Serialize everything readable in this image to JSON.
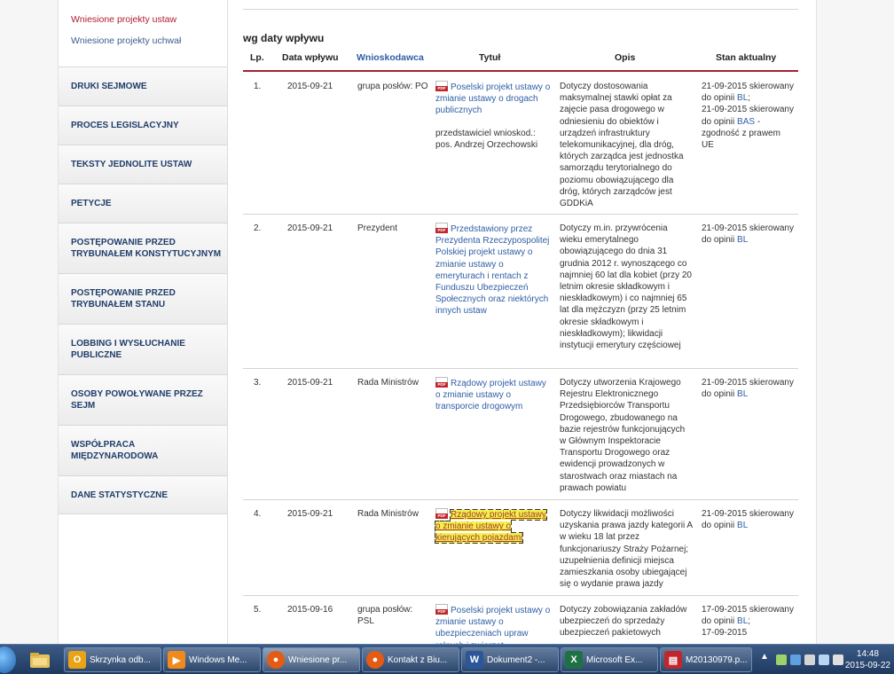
{
  "sidebar": {
    "sub_links": [
      "Wniesione projekty ustaw",
      "Wniesione projekty uchwał"
    ],
    "nav": [
      "DRUKI SEJMOWE",
      "PROCES LEGISLACYJNY",
      "TEKSTY JEDNOLITE USTAW",
      "PETYCJE",
      "POSTĘPOWANIE PRZED\nTRYBUNAŁEM KONSTYTUCYJNYM",
      "POSTĘPOWANIE PRZED\nTRYBUNAŁEM STANU",
      "LOBBING I WYSŁUCHANIE\nPUBLICZNE",
      "OSOBY POWOŁYWANE PRZEZ\nSEJM",
      "WSPÓŁPRACA\nMIĘDZYNARODOWA",
      "DANE STATYSTYCZNE"
    ]
  },
  "main": {
    "section_title": "wg daty wpływu",
    "headers": {
      "lp": "Lp.",
      "date": "Data wpływu",
      "applicant": "Wnioskodawca",
      "title": "Tytuł",
      "desc": "Opis",
      "state": "Stan aktualny"
    },
    "rows": [
      {
        "lp": "1.",
        "date": "2015-09-21",
        "applicant": "grupa posłów: PO",
        "title": "Poselski projekt ustawy o zmianie ustawy o drogach publicznych",
        "note": "przedstawiciel wnioskod.: pos. Andrzej Orzechowski",
        "desc": "Dotyczy dostosowania maksymalnej stawki opłat za zajęcie pasa drogowego w odniesieniu do obiektów i urządzeń infrastruktury telekomunikacyjnej, dla dróg, których zarządca jest jednostka samorządu terytorialnego do poziomu obowiązującego dla dróg, których zarządców jest GDDKiA",
        "state_1": "21-09-2015 skierowany do opinii",
        "state_1_link": "BL",
        "state_1_tail": ";",
        "state_2": "21-09-2015 skierowany do opinii",
        "state_2_link": "BAS",
        "state_2_tail": " - zgodność z prawem UE"
      },
      {
        "lp": "2.",
        "date": "2015-09-21",
        "applicant": "Prezydent",
        "title": "Przedstawiony przez Prezydenta Rzeczypospolitej Polskiej projekt ustawy o zmianie ustawy o emeryturach i rentach z Funduszu Ubezpieczeń Społecznych oraz niektórych innych ustaw",
        "desc": "Dotyczy m.in. przywrócenia wieku emerytalnego obowiązującego do dnia 31 grudnia 2012 r. wynoszącego co najmniej 60 lat dla kobiet (przy 20 letnim okresie składkowym i nieskładkowym) i co najmniej 65 lat dla mężczyzn (przy 25 letnim okresie składkowym i nieskładkowym); likwidacji instytucji emerytury częściowej",
        "state_1": "21-09-2015 skierowany do opinii",
        "state_1_link": "BL"
      },
      {
        "lp": "3.",
        "date": "2015-09-21",
        "applicant": "Rada Ministrów",
        "title": "Rządowy projekt ustawy o zmianie ustawy o transporcie drogowym",
        "desc": "Dotyczy utworzenia Krajowego Rejestru Elektronicznego Przedsiębiorców Transportu Drogowego, zbudowanego na bazie rejestrów funkcjonujących w Głównym Inspektoracie Transportu Drogowego oraz ewidencji prowadzonych w starostwach oraz miastach na prawach powiatu",
        "state_1": "21-09-2015 skierowany do opinii",
        "state_1_link": "BL"
      },
      {
        "lp": "4.",
        "date": "2015-09-21",
        "applicant": "Rada Ministrów",
        "title": "Rządowy projekt ustawy o zmianie ustawy o kierujących pojazdami",
        "desc": "Dotyczy likwidacji możliwości uzyskania prawa jazdy kategorii A w wieku 18 lat przez funkcjonariuszy Straży Pożarnej; uzupełnienia definicji miejsca zamieszkania osoby ubiegającej się o wydanie prawa jazdy",
        "state_1": "21-09-2015 skierowany do opinii",
        "state_1_link": "BL"
      },
      {
        "lp": "5.",
        "date": "2015-09-16",
        "applicant": "grupa posłów: PSL",
        "title": "Poselski projekt ustawy o zmianie ustawy o ubezpieczeniach upraw rolnych i zwierząt",
        "desc": "Dotyczy zobowiązania zakładów ubezpieczeń do sprzedaży ubezpieczeń pakietowych",
        "state_1": "17-09-2015 skierowany do opinii",
        "state_1_link": "BL",
        "state_1_tail": ";",
        "state_2": "17-09-2015"
      }
    ]
  },
  "taskbar": {
    "buttons": [
      {
        "label": "Skrzynka odb...",
        "icon": "outlook-icon",
        "color": "#e8a317"
      },
      {
        "label": "Windows Me...",
        "icon": "media-player-icon",
        "color": "#f08a1c"
      },
      {
        "label": "Wniesione pr...",
        "icon": "firefox-icon",
        "color": "#e55b13"
      },
      {
        "label": "Kontakt z Biu...",
        "icon": "firefox-icon",
        "color": "#e55b13"
      },
      {
        "label": "Dokument2 -...",
        "icon": "word-icon",
        "color": "#2b579a"
      },
      {
        "label": "Microsoft Ex...",
        "icon": "excel-icon",
        "color": "#1e7145"
      },
      {
        "label": "M20130979.p...",
        "icon": "pdf-icon",
        "color": "#c0272d"
      }
    ],
    "time": "14:48",
    "date": "2015-09-22"
  }
}
